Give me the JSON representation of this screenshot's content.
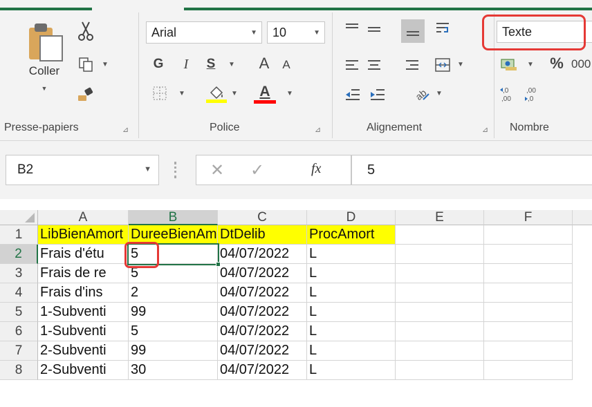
{
  "ribbon": {
    "clipboard": {
      "paste_label": "Coller",
      "group_label": "Presse-papiers"
    },
    "font": {
      "family": "Arial",
      "size": "10",
      "bold": "G",
      "italic": "I",
      "underline": "S",
      "grow": "A",
      "shrink": "A",
      "color_letter": "A",
      "group_label": "Police"
    },
    "alignment": {
      "group_label": "Alignement"
    },
    "number": {
      "format": "Texte",
      "percent": "%",
      "comma": "000",
      "group_label": "Nombre"
    },
    "colors": {
      "accent": "#217346",
      "highlight": "#ffff00",
      "font_color": "#ff0000",
      "callout": "#e53935"
    }
  },
  "formula_bar": {
    "name_box": "B2",
    "fx": "fx",
    "value": "5"
  },
  "grid": {
    "columns": [
      "A",
      "B",
      "C",
      "D",
      "E",
      "F"
    ],
    "selected_column": "B",
    "selected_row": "2",
    "rows": [
      {
        "n": "1",
        "cells": [
          "LibBienAmort",
          "DureeBienAmort",
          "DtDelib",
          "ProcAmort",
          "",
          ""
        ]
      },
      {
        "n": "2",
        "cells": [
          "Frais d'étu",
          "5",
          "04/07/2022",
          "L",
          "",
          ""
        ]
      },
      {
        "n": "3",
        "cells": [
          "Frais de re",
          "5",
          "04/07/2022",
          "L",
          "",
          ""
        ]
      },
      {
        "n": "4",
        "cells": [
          "Frais d'ins",
          "2",
          "04/07/2022",
          "L",
          "",
          ""
        ]
      },
      {
        "n": "5",
        "cells": [
          "1-Subventi",
          "99",
          "04/07/2022",
          "L",
          "",
          ""
        ]
      },
      {
        "n": "6",
        "cells": [
          "1-Subventi",
          "5",
          "04/07/2022",
          "L",
          "",
          ""
        ]
      },
      {
        "n": "7",
        "cells": [
          "2-Subventi",
          "99",
          "04/07/2022",
          "L",
          "",
          ""
        ]
      },
      {
        "n": "8",
        "cells": [
          "2-Subventi",
          "30",
          "04/07/2022",
          "L",
          "",
          ""
        ]
      }
    ]
  }
}
